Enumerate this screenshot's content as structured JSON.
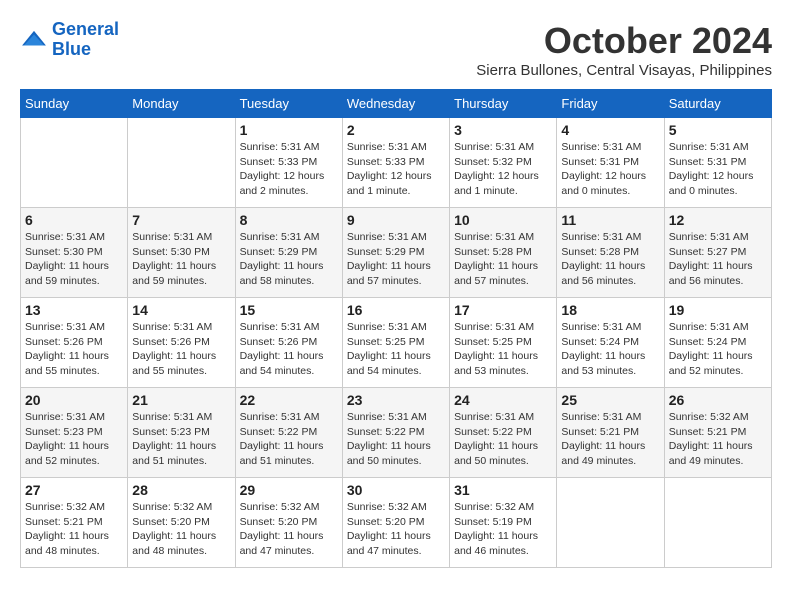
{
  "logo": {
    "line1": "General",
    "line2": "Blue"
  },
  "title": "October 2024",
  "location": "Sierra Bullones, Central Visayas, Philippines",
  "weekdays": [
    "Sunday",
    "Monday",
    "Tuesday",
    "Wednesday",
    "Thursday",
    "Friday",
    "Saturday"
  ],
  "weeks": [
    [
      {
        "day": "",
        "info": ""
      },
      {
        "day": "",
        "info": ""
      },
      {
        "day": "1",
        "info": "Sunrise: 5:31 AM\nSunset: 5:33 PM\nDaylight: 12 hours\nand 2 minutes."
      },
      {
        "day": "2",
        "info": "Sunrise: 5:31 AM\nSunset: 5:33 PM\nDaylight: 12 hours\nand 1 minute."
      },
      {
        "day": "3",
        "info": "Sunrise: 5:31 AM\nSunset: 5:32 PM\nDaylight: 12 hours\nand 1 minute."
      },
      {
        "day": "4",
        "info": "Sunrise: 5:31 AM\nSunset: 5:31 PM\nDaylight: 12 hours\nand 0 minutes."
      },
      {
        "day": "5",
        "info": "Sunrise: 5:31 AM\nSunset: 5:31 PM\nDaylight: 12 hours\nand 0 minutes."
      }
    ],
    [
      {
        "day": "6",
        "info": "Sunrise: 5:31 AM\nSunset: 5:30 PM\nDaylight: 11 hours\nand 59 minutes."
      },
      {
        "day": "7",
        "info": "Sunrise: 5:31 AM\nSunset: 5:30 PM\nDaylight: 11 hours\nand 59 minutes."
      },
      {
        "day": "8",
        "info": "Sunrise: 5:31 AM\nSunset: 5:29 PM\nDaylight: 11 hours\nand 58 minutes."
      },
      {
        "day": "9",
        "info": "Sunrise: 5:31 AM\nSunset: 5:29 PM\nDaylight: 11 hours\nand 57 minutes."
      },
      {
        "day": "10",
        "info": "Sunrise: 5:31 AM\nSunset: 5:28 PM\nDaylight: 11 hours\nand 57 minutes."
      },
      {
        "day": "11",
        "info": "Sunrise: 5:31 AM\nSunset: 5:28 PM\nDaylight: 11 hours\nand 56 minutes."
      },
      {
        "day": "12",
        "info": "Sunrise: 5:31 AM\nSunset: 5:27 PM\nDaylight: 11 hours\nand 56 minutes."
      }
    ],
    [
      {
        "day": "13",
        "info": "Sunrise: 5:31 AM\nSunset: 5:26 PM\nDaylight: 11 hours\nand 55 minutes."
      },
      {
        "day": "14",
        "info": "Sunrise: 5:31 AM\nSunset: 5:26 PM\nDaylight: 11 hours\nand 55 minutes."
      },
      {
        "day": "15",
        "info": "Sunrise: 5:31 AM\nSunset: 5:26 PM\nDaylight: 11 hours\nand 54 minutes."
      },
      {
        "day": "16",
        "info": "Sunrise: 5:31 AM\nSunset: 5:25 PM\nDaylight: 11 hours\nand 54 minutes."
      },
      {
        "day": "17",
        "info": "Sunrise: 5:31 AM\nSunset: 5:25 PM\nDaylight: 11 hours\nand 53 minutes."
      },
      {
        "day": "18",
        "info": "Sunrise: 5:31 AM\nSunset: 5:24 PM\nDaylight: 11 hours\nand 53 minutes."
      },
      {
        "day": "19",
        "info": "Sunrise: 5:31 AM\nSunset: 5:24 PM\nDaylight: 11 hours\nand 52 minutes."
      }
    ],
    [
      {
        "day": "20",
        "info": "Sunrise: 5:31 AM\nSunset: 5:23 PM\nDaylight: 11 hours\nand 52 minutes."
      },
      {
        "day": "21",
        "info": "Sunrise: 5:31 AM\nSunset: 5:23 PM\nDaylight: 11 hours\nand 51 minutes."
      },
      {
        "day": "22",
        "info": "Sunrise: 5:31 AM\nSunset: 5:22 PM\nDaylight: 11 hours\nand 51 minutes."
      },
      {
        "day": "23",
        "info": "Sunrise: 5:31 AM\nSunset: 5:22 PM\nDaylight: 11 hours\nand 50 minutes."
      },
      {
        "day": "24",
        "info": "Sunrise: 5:31 AM\nSunset: 5:22 PM\nDaylight: 11 hours\nand 50 minutes."
      },
      {
        "day": "25",
        "info": "Sunrise: 5:31 AM\nSunset: 5:21 PM\nDaylight: 11 hours\nand 49 minutes."
      },
      {
        "day": "26",
        "info": "Sunrise: 5:32 AM\nSunset: 5:21 PM\nDaylight: 11 hours\nand 49 minutes."
      }
    ],
    [
      {
        "day": "27",
        "info": "Sunrise: 5:32 AM\nSunset: 5:21 PM\nDaylight: 11 hours\nand 48 minutes."
      },
      {
        "day": "28",
        "info": "Sunrise: 5:32 AM\nSunset: 5:20 PM\nDaylight: 11 hours\nand 48 minutes."
      },
      {
        "day": "29",
        "info": "Sunrise: 5:32 AM\nSunset: 5:20 PM\nDaylight: 11 hours\nand 47 minutes."
      },
      {
        "day": "30",
        "info": "Sunrise: 5:32 AM\nSunset: 5:20 PM\nDaylight: 11 hours\nand 47 minutes."
      },
      {
        "day": "31",
        "info": "Sunrise: 5:32 AM\nSunset: 5:19 PM\nDaylight: 11 hours\nand 46 minutes."
      },
      {
        "day": "",
        "info": ""
      },
      {
        "day": "",
        "info": ""
      }
    ]
  ]
}
